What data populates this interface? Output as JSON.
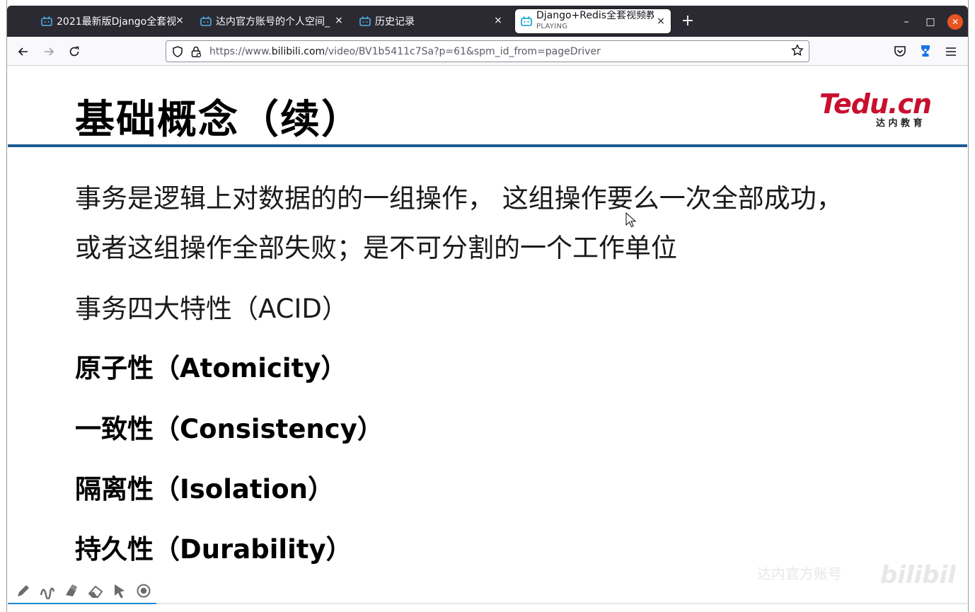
{
  "browser": {
    "tabs": [
      {
        "title": "2021最新版Django全套视",
        "icon": "bilibili-tv-icon",
        "active": false
      },
      {
        "title": "达内官方账号的个人空间_",
        "icon": "bilibili-tv-icon",
        "active": false
      },
      {
        "title": "历史记录",
        "icon": "bilibili-tv-icon",
        "active": false
      },
      {
        "title": "Django+Redis全套视频教",
        "subtitle": "PLAYING",
        "icon": "bilibili-tv-icon",
        "active": true
      }
    ],
    "tab_close_glyph": "×",
    "new_tab_glyph": "+",
    "window_controls": {
      "minimize": "–",
      "maximize": "□",
      "close": "✕"
    },
    "url": {
      "scheme": "https://www.",
      "host": "bilibili.com",
      "path": "/video/BV1b5411c7Sa?p=61&spm_id_from=pageDriver"
    }
  },
  "slide": {
    "title": "基础概念（续）",
    "logo_text": "Tedu.cn",
    "logo_subtext": "达 内 教 育",
    "paragraphs": [
      "事务是逻辑上对数据的的一组操作， 这组操作要么一次全部成功，",
      "或者这组操作全部失败；是不可分割的一个工作单位",
      "事务四大特性（ACID）"
    ],
    "properties": [
      "原子性（Atomicity）",
      "一致性（Consistency）",
      "隔离性（Isolation）",
      "持久性（Durability）"
    ]
  },
  "player": {
    "progress_fraction": 0.155,
    "watermark_text": "达内官方账号",
    "watermark_brand": "bilibili"
  },
  "colors": {
    "tabstrip": "#2b2a33",
    "accent_rule": "#1d5b94",
    "logo_red": "#c8102e",
    "progress": "#1f8ad6",
    "close_button": "#e95420"
  }
}
